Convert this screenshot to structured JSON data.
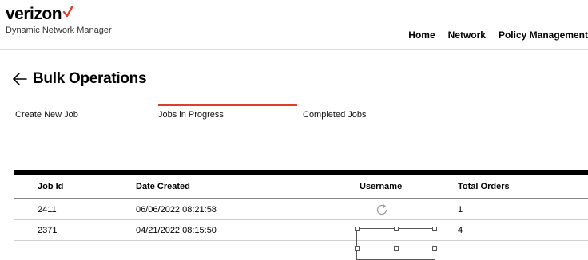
{
  "brand": {
    "name": "verizon",
    "subtitle": "Dynamic Network Manager",
    "accent_color": "#e23b2a"
  },
  "topnav": {
    "items": [
      "Home",
      "Network",
      "Policy Management"
    ]
  },
  "page": {
    "title": "Bulk Operations",
    "back_icon": "left-arrow-icon"
  },
  "tabs": [
    {
      "label": "Create New Job",
      "active": false
    },
    {
      "label": "Jobs in Progress",
      "active": true
    },
    {
      "label": "Completed Jobs",
      "active": false
    }
  ],
  "table": {
    "headers": [
      "Job Id",
      "Date Created",
      "Username",
      "Total Orders"
    ],
    "rows": [
      {
        "job_id": "2411",
        "date_created": "06/06/2022 08:21:58",
        "username": "",
        "total_orders": "1"
      },
      {
        "job_id": "2371",
        "date_created": "04/21/2022 08:15:50",
        "username": "",
        "total_orders": "4"
      }
    ]
  },
  "overlay": {
    "rotate_icon": "rotate-icon",
    "selection": "selection-box"
  }
}
